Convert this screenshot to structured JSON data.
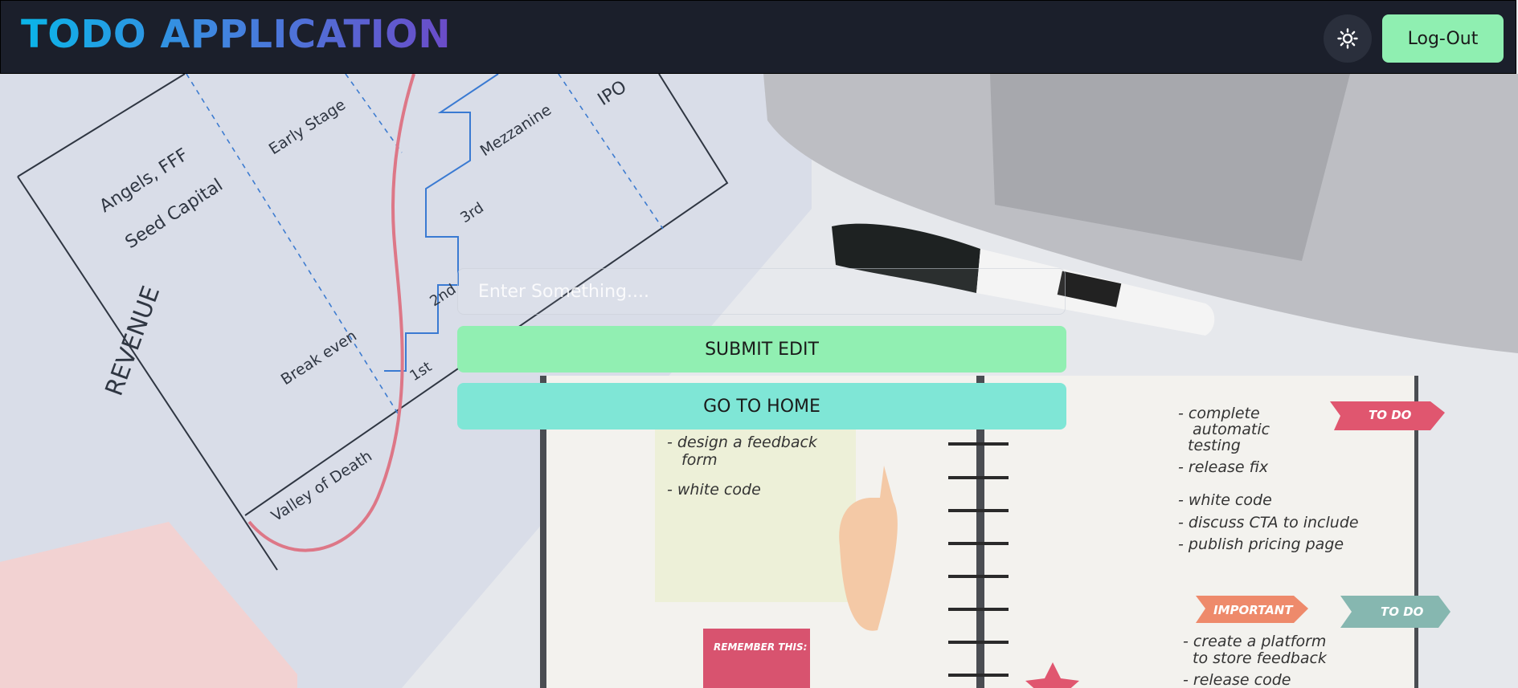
{
  "header": {
    "title": "TODO APPLICATION",
    "theme_icon": "sun-icon",
    "logout_label": "Log-Out"
  },
  "form": {
    "input_placeholder": "Enter Something....",
    "input_value": "",
    "submit_label": "SUBMIT EDIT",
    "home_label": "GO TO HOME"
  },
  "colors": {
    "navbar": "#1b1f2b",
    "logout_button": "#8fefb1",
    "submit_button": "#91efb2",
    "home_button": "#7fe6d6"
  },
  "background": {
    "chart_labels": {
      "revenue": "REVENUE",
      "angels": "Angels, FFF",
      "seed": "Seed Capital",
      "early": "Early Stage",
      "mezzanine": "Mezzanine",
      "ipo": "IPO",
      "third": "3rd",
      "second": "2nd",
      "first": "1st",
      "break_even": "Break even",
      "valley": "Valley of Death"
    },
    "notebook": {
      "sticky_lines": [
        "- design a feedback",
        "form",
        "- white code"
      ],
      "right_lines": [
        "- complete",
        "automatic",
        "testing",
        "- release fix",
        "- white code",
        "- discuss CTA to include",
        "- publish pricing page",
        "- create a platform",
        "to store feedback",
        "- release code"
      ],
      "tag_todo_1": "TO DO",
      "tag_important": "IMPORTANT",
      "tag_todo_2": "TO DO",
      "remember": "REMEMBER THIS:"
    }
  }
}
